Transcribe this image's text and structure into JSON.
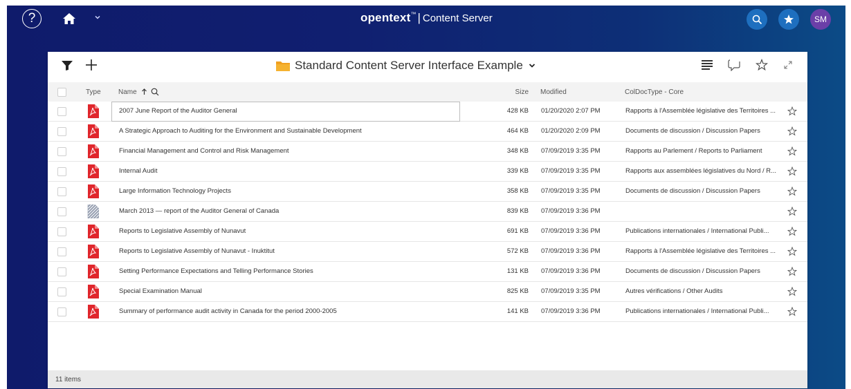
{
  "topbar": {
    "help_label": "?",
    "brand_logo": "opentext",
    "brand_reg": "™",
    "brand_separator": "|",
    "brand_product": "Content Server",
    "avatar_initials": "SM",
    "icons": [
      "help-icon",
      "home-icon",
      "chevron-down-icon",
      "search-icon",
      "star-icon"
    ]
  },
  "panel": {
    "folder_title": "Standard Content Server Interface Example",
    "toolbar_icons": [
      "filter-icon",
      "add-icon",
      "folder-icon",
      "description-icon",
      "comment-icon",
      "favorite-star-icon",
      "expand-icon"
    ],
    "columns": {
      "type": "Type",
      "name": "Name",
      "size": "Size",
      "modified": "Modified",
      "coldoctype": "ColDocType - Core"
    },
    "rows": [
      {
        "icon": "pdf",
        "name": "2007 June Report of the Auditor General",
        "size": "428 KB",
        "modified": "01/20/2020 2:07 PM",
        "coldoctype": "Rapports à l'Assemblée législative des Territoires ..."
      },
      {
        "icon": "pdf",
        "name": "A Strategic Approach to Auditing for the Environment and Sustainable Development",
        "size": "464 KB",
        "modified": "01/20/2020 2:09 PM",
        "coldoctype": "Documents de discussion / Discussion Papers"
      },
      {
        "icon": "pdf",
        "name": "Financial Management and Control and Risk Management",
        "size": "348 KB",
        "modified": "07/09/2019 3:35 PM",
        "coldoctype": "Rapports au Parlement / Reports to Parliament"
      },
      {
        "icon": "pdf",
        "name": "Internal Audit",
        "size": "339 KB",
        "modified": "07/09/2019 3:35 PM",
        "coldoctype": "Rapports aux assemblées législatives du Nord / R..."
      },
      {
        "icon": "pdf",
        "name": "Large Information Technology Projects",
        "size": "358 KB",
        "modified": "07/09/2019 3:35 PM",
        "coldoctype": "Documents de discussion / Discussion Papers"
      },
      {
        "icon": "generic",
        "name": "March 2013 — report of the Auditor General of Canada",
        "size": "839 KB",
        "modified": "07/09/2019 3:36 PM",
        "coldoctype": ""
      },
      {
        "icon": "pdf",
        "name": "Reports to Legislative Assembly of Nunavut",
        "size": "691 KB",
        "modified": "07/09/2019 3:36 PM",
        "coldoctype": "Publications internationales / International Publi..."
      },
      {
        "icon": "pdf",
        "name": "Reports to Legislative Assembly of Nunavut - Inuktitut",
        "size": "572 KB",
        "modified": "07/09/2019 3:36 PM",
        "coldoctype": "Rapports à l'Assemblée législative des Territoires ..."
      },
      {
        "icon": "pdf",
        "name": "Setting Performance Expectations and Telling Performance Stories",
        "size": "131 KB",
        "modified": "07/09/2019 3:36 PM",
        "coldoctype": "Documents de discussion / Discussion Papers"
      },
      {
        "icon": "pdf",
        "name": "Special Examination Manual",
        "size": "825 KB",
        "modified": "07/09/2019 3:35 PM",
        "coldoctype": "Autres vérifications / Other Audits"
      },
      {
        "icon": "pdf",
        "name": "Summary of performance audit activity in Canada for the period 2000-2005",
        "size": "141 KB",
        "modified": "07/09/2019 3:36 PM",
        "coldoctype": "Publications internationales / International Publi..."
      }
    ],
    "footer_count": "11 items"
  },
  "colors": {
    "header_gradient_start": "#0f1b6b",
    "header_gradient_end": "#0c4b86",
    "button_blue": "#1e6fbf",
    "avatar_purple": "#6b3fa8",
    "pdf_red": "#e0262c",
    "folder_orange": "#f0a020"
  }
}
